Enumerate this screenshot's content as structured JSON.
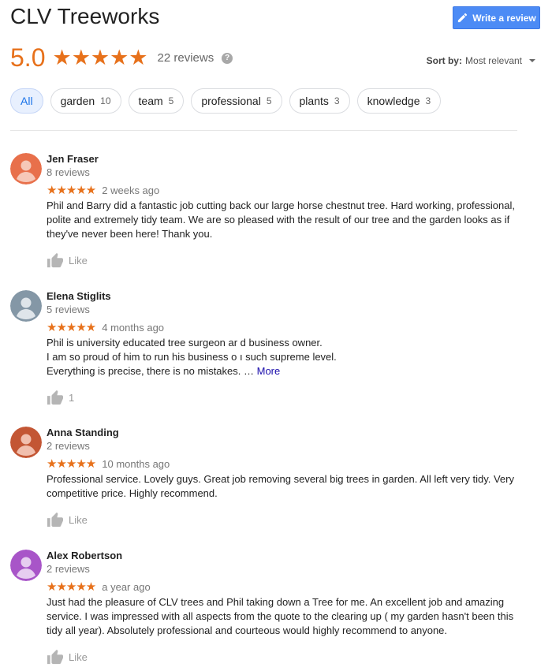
{
  "header": {
    "title": "CLV Treeworks",
    "write_review_label": "Write a review"
  },
  "summary": {
    "rating": "5.0",
    "stars": "★★★★★",
    "review_count": "22 reviews",
    "help_glyph": "?"
  },
  "sort": {
    "label": "Sort by:",
    "value": "Most relevant"
  },
  "filters": [
    {
      "label": "All",
      "count": ""
    },
    {
      "label": "garden",
      "count": "10"
    },
    {
      "label": "team",
      "count": "5"
    },
    {
      "label": "professional",
      "count": "5"
    },
    {
      "label": "plants",
      "count": "3"
    },
    {
      "label": "knowledge",
      "count": "3"
    }
  ],
  "reviews": [
    {
      "name": "Jen Fraser",
      "sub": "8 reviews",
      "stars": "★★★★★",
      "date": "2 weeks ago",
      "text": "Phil and Barry did a fantastic  job cutting back our large horse chestnut  tree. Hard working, professional, polite  and extremely  tidy team. We are so pleased  with the result  of our tree and the garden looks as if they've never been here!  Thank you.",
      "more": "",
      "like": "Like",
      "avatar_color": "#e8704b"
    },
    {
      "name": "Elena Stiglits",
      "sub": "5 reviews",
      "stars": "★★★★★",
      "date": "4 months ago",
      "text_lines": [
        "Phil is university educated tree surgeon ar d business owner.",
        "I am so proud of him to run his business o ı such supreme level.",
        "Everything is precise,  there is no mistakes. …"
      ],
      "more": "More",
      "like": "1",
      "avatar_color": "#8497a6"
    },
    {
      "name": "Anna Standing",
      "sub": "2 reviews",
      "stars": "★★★★★",
      "date": "10 months ago",
      "text": "Professional service. Lovely guys. Great job removing several big trees in garden. All left very tidy. Very competitive price. Highly recommend.",
      "more": "",
      "like": "Like",
      "avatar_color": "#c35634"
    },
    {
      "name": "Alex Robertson",
      "sub": "2 reviews",
      "stars": "★★★★★",
      "date": "a year ago",
      "text": "Just had the pleasure of CLV trees and Phil taking down a Tree for me. An excellent job and amazing service. I was impressed with all aspects from the quote to the clearing up ( my garden hasn't been this tidy all year). Absolutely professional and courteous would highly recommend to anyone.",
      "more": "",
      "like": "Like",
      "avatar_color": "#a855c8"
    }
  ],
  "colors": {
    "accent_star": "#e7711b",
    "button_blue": "#4c8bf5",
    "link": "#1a0dab"
  }
}
